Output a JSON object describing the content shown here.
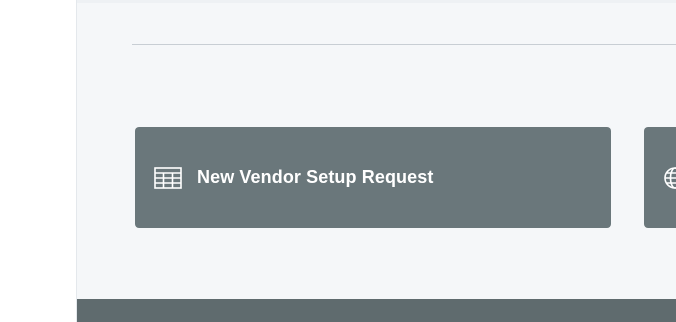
{
  "main": {
    "tiles": [
      {
        "label": "New Vendor Setup Request",
        "icon": "table-icon"
      },
      {
        "label": "",
        "icon": "globe-icon"
      }
    ]
  },
  "colors": {
    "tile_background": "#6a777b",
    "panel_background": "#f5f7f9",
    "bottom_bar": "#5f6b6e"
  }
}
